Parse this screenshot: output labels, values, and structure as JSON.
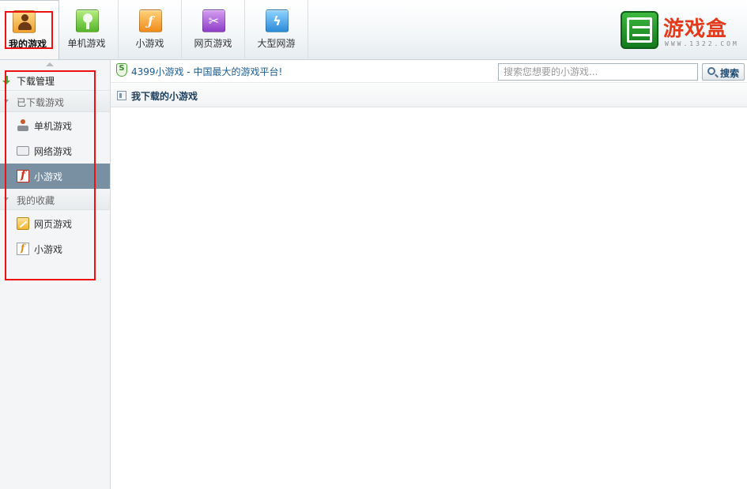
{
  "toolbar": {
    "tabs": [
      {
        "label": "我的游戏",
        "icon": "user-icon"
      },
      {
        "label": "单机游戏",
        "icon": "lightbulb-icon"
      },
      {
        "label": "小游戏",
        "icon": "flash-icon"
      },
      {
        "label": "网页游戏",
        "icon": "tools-icon"
      },
      {
        "label": "大型网游",
        "icon": "lightning-icon"
      }
    ],
    "logo": {
      "text": "游戏盒",
      "subtext": "WWW.1322.COM"
    }
  },
  "sidebar": {
    "header": "下载管理",
    "groups": [
      {
        "label": "已下载游戏",
        "items": [
          {
            "label": "单机游戏",
            "icon": "joystick-icon"
          },
          {
            "label": "网络游戏",
            "icon": "keyboard-icon"
          },
          {
            "label": "小游戏",
            "icon": "flash-icon"
          }
        ]
      },
      {
        "label": "我的收藏",
        "items": [
          {
            "label": "网页游戏",
            "icon": "web-game-icon"
          },
          {
            "label": "小游戏",
            "icon": "flash-doc-icon"
          }
        ]
      }
    ],
    "selected": "小游戏"
  },
  "infobar": {
    "brand": "4399小游戏",
    "slogan": " - 中国最大的游戏平台!",
    "search_placeholder": "搜索您想要的小游戏...",
    "search_button": "搜索"
  },
  "section": {
    "title": "我下载的小游戏"
  },
  "colors": {
    "selected_bg": "#7990a3",
    "annotation": "#ee1111",
    "logo_text": "#e23a1a",
    "link_blue": "#1b5c8f"
  }
}
